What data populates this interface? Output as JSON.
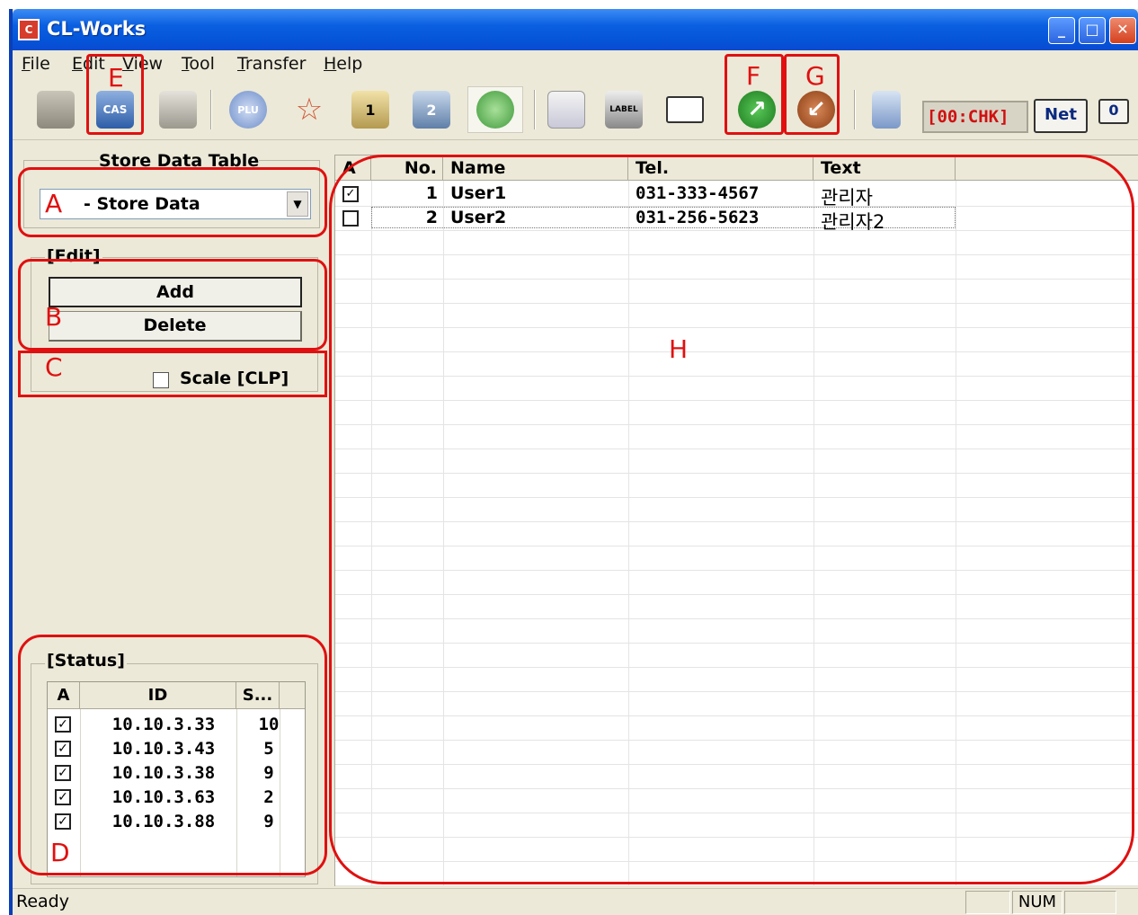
{
  "window": {
    "title": "CL-Works"
  },
  "menu": [
    {
      "label": "File"
    },
    {
      "label": "Edit"
    },
    {
      "label": "View"
    },
    {
      "label": "Tool"
    },
    {
      "label": "Transfer"
    },
    {
      "label": "Help"
    }
  ],
  "toolbar": {
    "status_code": "[00:CHK]",
    "net_label": "Net",
    "zero_label": "0",
    "icons": [
      "open-folder-icon",
      "save-icon",
      "print-icon",
      "plu-icon",
      "star-icon",
      "user1-icon",
      "user2-icon",
      "store-users-icon",
      "grid-icon",
      "label-icon",
      "keyboard-icon",
      "send-icon",
      "receive-icon",
      "settings-icon"
    ]
  },
  "left": {
    "heading": "Store Data Table",
    "combo_value": "- Store Data",
    "edit_group": "[Edit]",
    "add_label": "Add",
    "delete_label": "Delete",
    "scale_label": "Scale [CLP]",
    "status_group": "[Status]",
    "status_columns": {
      "a": "A",
      "id": "ID",
      "s": "S..."
    },
    "status_rows": [
      {
        "checked": true,
        "id": "10.10.3.33",
        "s": "10"
      },
      {
        "checked": true,
        "id": "10.10.3.43",
        "s": "5"
      },
      {
        "checked": true,
        "id": "10.10.3.38",
        "s": "9"
      },
      {
        "checked": true,
        "id": "10.10.3.63",
        "s": "2"
      },
      {
        "checked": true,
        "id": "10.10.3.88",
        "s": "9"
      }
    ]
  },
  "grid": {
    "columns": {
      "a": "A",
      "no": "No.",
      "name": "Name",
      "tel": "Tel.",
      "text": "Text"
    },
    "rows": [
      {
        "checked": true,
        "no": "1",
        "name": "User1",
        "tel": "031-333-4567",
        "text": "관리자"
      },
      {
        "checked": false,
        "no": "2",
        "name": "User2",
        "tel": "031-256-5623",
        "text": "관리자2"
      }
    ]
  },
  "statusbar": {
    "text": "Ready",
    "num": "NUM"
  },
  "annotations": {
    "a": "A",
    "b": "B",
    "c": "C",
    "d": "D",
    "e": "E",
    "f": "F",
    "g": "G",
    "h": "H"
  },
  "colors": {
    "annotation": "#e01010",
    "title_bar": "#0a5fe0",
    "chk_text": "#d01010"
  }
}
